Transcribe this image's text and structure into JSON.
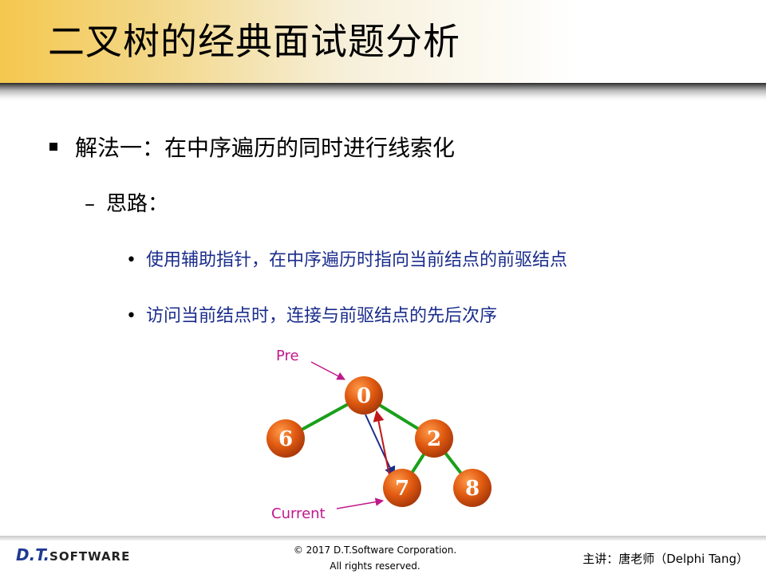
{
  "slide": {
    "title": "二叉树的经典面试题分析",
    "bullet1": "解法一：在中序遍历的同时进行线索化",
    "bullet2": "思路：",
    "bullet2_dash": "–",
    "bullet3": [
      "使用辅助指针，在中序遍历时指向当前结点的前驱结点",
      "访问当前结点时，连接与前驱结点的先后次序"
    ],
    "bullet3_marker": "•"
  },
  "diagram": {
    "nodes": [
      "0",
      "6",
      "2",
      "7",
      "8"
    ],
    "labels": {
      "pre": "Pre",
      "current": "Current"
    },
    "colors": {
      "node": "#e05a10",
      "edge": "#1aa01a",
      "label": "#c0188a",
      "arrow_down": "#1a2c8c",
      "arrow_up": "#c01818"
    }
  },
  "footer": {
    "logo_dt": "D.T.",
    "logo_software": "SOFTWARE",
    "copyright_line1": "© 2017 D.T.Software Corporation.",
    "copyright_line2": "All rights reserved.",
    "presenter": "主讲：唐老师（Delphi Tang）"
  }
}
